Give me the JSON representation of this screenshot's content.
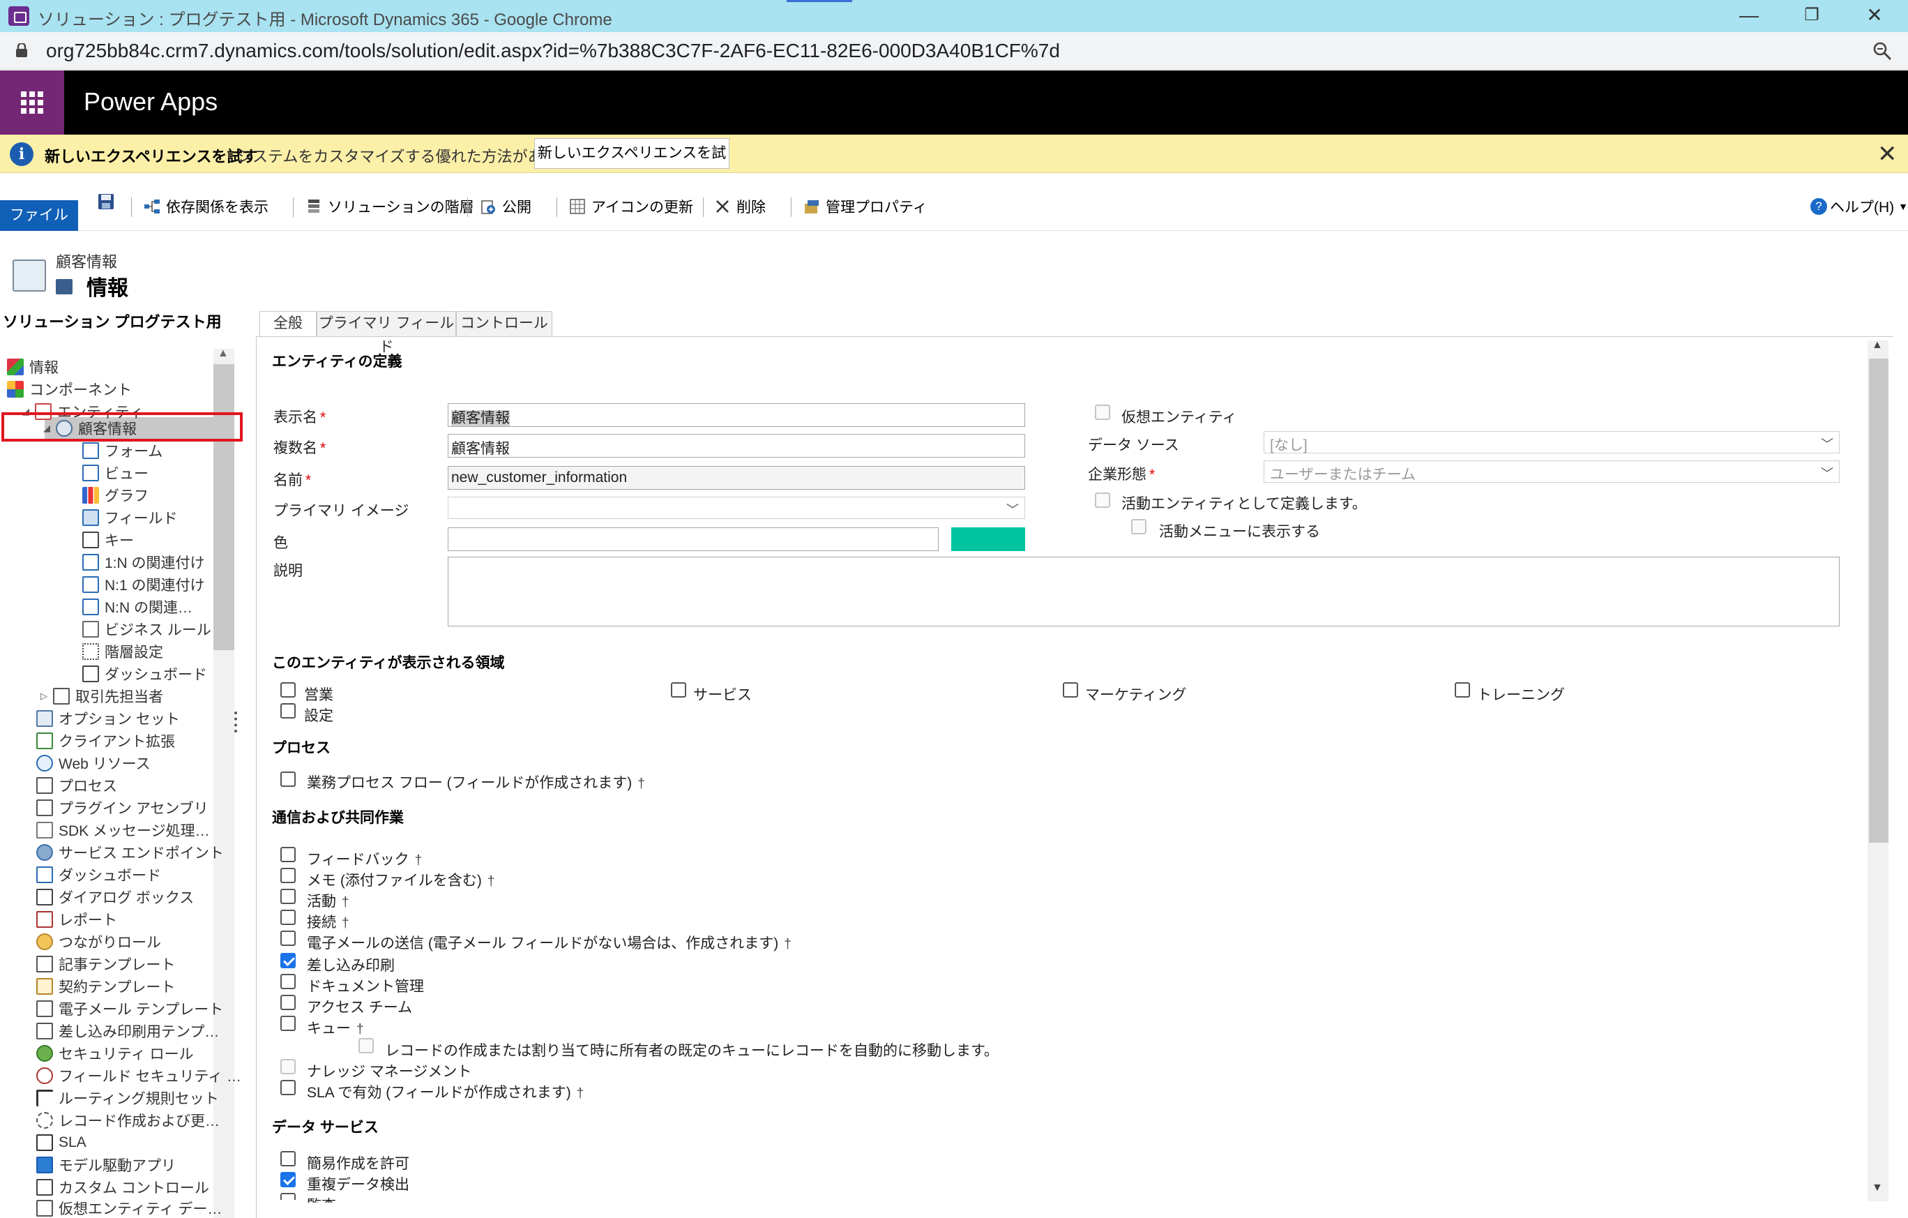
{
  "window": {
    "title": "ソリューション : プログテスト用 - Microsoft Dynamics 365 - Google Chrome",
    "controls": [
      "—",
      "❐",
      "✕"
    ]
  },
  "address": {
    "url": "org725bb84c.crm7.dynamics.com/tools/solution/edit.aspx?id=%7b388C3C7F-2AF6-EC11-82E6-000D3A40B1CF%7d"
  },
  "header": {
    "brand": "Power Apps",
    "brand_color": "#742774"
  },
  "notification": {
    "bold": "新しいエクスペリエンスを試す",
    "message": "システムをカスタマイズする優れた方法があります",
    "button": "新しいエクスペリエンスを試す",
    "close": "✕"
  },
  "ribbon": {
    "file": "ファイル",
    "show_dependencies": "依存関係を表示",
    "solution_layers": "ソリューションの階層",
    "publish": "公開",
    "update_icons": "アイコンの更新",
    "delete": "削除",
    "managed_properties": "管理プロパティ",
    "help": "ヘルプ(H)",
    "help_mark": "?"
  },
  "nav": {
    "entity_small": "顧客情報",
    "entity_big": "情報",
    "solution": "ソリューション プログテスト用",
    "items": {
      "info": "情報",
      "components": "コンポーネント",
      "entities": "エンティティ",
      "customer_info": "顧客情報",
      "forms": "フォーム",
      "views": "ビュー",
      "charts": "グラフ",
      "fields": "フィールド",
      "keys": "キー",
      "rel_1n": "1:N の関連付け",
      "rel_n1": "N:1 の関連付け",
      "rel_nn": "N:N の関連…",
      "business_rules": "ビジネス ルール",
      "hierarchy": "階層設定",
      "dashboards_sub": "ダッシュボード",
      "contacts": "取引先担当者",
      "option_sets": "オプション セット",
      "client_ext": "クライアント拡張",
      "web_resources": "Web リソース",
      "processes": "プロセス",
      "plugins": "プラグイン アセンブリ",
      "sdk": "SDK メッセージ処理…",
      "service_endpoints": "サービス エンドポイント",
      "dashboards": "ダッシュボード",
      "dialogs": "ダイアログ ボックス",
      "reports": "レポート",
      "connection_roles": "つながりロール",
      "article_templates": "記事テンプレート",
      "contract_templates": "契約テンプレート",
      "email_templates": "電子メール テンプレート",
      "mailmerge_templates": "差し込み印刷用テンプ…",
      "security_roles": "セキュリティ ロール",
      "field_security": "フィールド セキュリティ …",
      "routing_rules": "ルーティング規則セット",
      "record_creation": "レコード作成および更…",
      "sla": "SLA",
      "model_apps": "モデル駆動アプリ",
      "custom_controls": "カスタム コントロール",
      "virtual_entities": "仮想エンティティ デー…"
    }
  },
  "tabs": [
    "全般",
    "プライマリ フィールド",
    "コントロール"
  ],
  "form": {
    "definition_header": "エンティティの定義",
    "display_name_label": "表示名",
    "display_name_value": "顧客情報",
    "plural_name_label": "複数名",
    "plural_name_value": "顧客情報",
    "name_label": "名前",
    "name_value": "new_customer_information",
    "primary_image_label": "プライマリ イメージ",
    "color_label": "色",
    "color_swatch": "#00c4a0",
    "description_label": "説明",
    "required_mark": "*",
    "virtual_entity": "仮想エンティティ",
    "data_source_label": "データ ソース",
    "data_source_value": "[なし]",
    "ownership_label": "企業形態",
    "ownership_value": "ユーザーまたはチーム",
    "activity_entity": "活動エンティティとして定義します。",
    "show_in_activity_menu": "活動メニューに表示する",
    "areas_header": "このエンティティが表示される領域",
    "area_sales": "営業",
    "area_service": "サービス",
    "area_marketing": "マーケティング",
    "area_training": "トレーニング",
    "area_settings": "設定",
    "process_header": "プロセス",
    "bpf": "業務プロセス フロー (フィールドが作成されます)",
    "comm_header": "通信および共同作業",
    "feedback": "フィードバック",
    "notes": "メモ (添付ファイルを含む)",
    "activities": "活動",
    "connections": "接続",
    "send_email": "電子メールの送信 (電子メール フィールドがない場合は、作成されます)",
    "mail_merge": "差し込み印刷",
    "doc_mgmt": "ドキュメント管理",
    "access_teams": "アクセス チーム",
    "queues": "キュー",
    "queue_auto": "レコードの作成または割り当て時に所有者の既定のキューにレコードを自動的に移動します。",
    "knowledge": "ナレッジ マネージメント",
    "sla_enabled": "SLA で有効 (フィールドが作成されます)",
    "data_services_header": "データ サービス",
    "quick_create": "簡易作成を許可",
    "duplicate_detection": "重複データ検出",
    "audit": "監査",
    "dagger": "†",
    "chevron": "﹀"
  }
}
